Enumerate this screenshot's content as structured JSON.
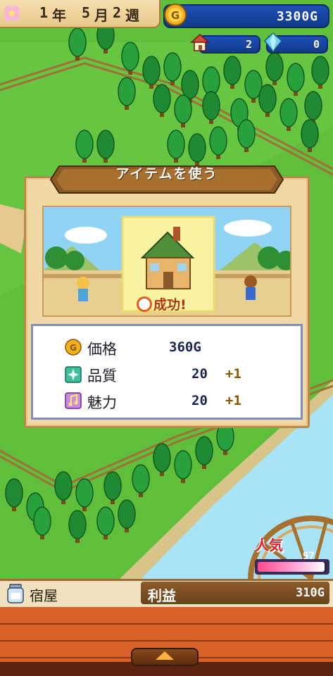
{
  "top_bar": {
    "year_num": "1",
    "year_unit": "年",
    "month_num": "5",
    "month_unit": "月",
    "week_num": "2",
    "week_unit": "週",
    "money": "3300G",
    "houses": "2",
    "crystals": "0"
  },
  "dialog": {
    "title": "アイテムを使う",
    "result": "成功!",
    "rows": [
      {
        "label": "価格",
        "value": "360G",
        "bonus": "",
        "icon": "coin-icon"
      },
      {
        "label": "品質",
        "value": "20",
        "bonus": "+1",
        "icon": "quality-icon"
      },
      {
        "label": "魅力",
        "value": "20",
        "bonus": "+1",
        "icon": "charm-music-icon"
      }
    ]
  },
  "popularity": {
    "label": "人気",
    "value": "97",
    "level_fraction": 0.97
  },
  "bottom_bar": {
    "building": "宿屋",
    "profit_label": "利益",
    "profit_value": "310G"
  },
  "colors": {
    "grass": "#5fbf3a",
    "river": "#9fe0f2",
    "panel_blue": "#1d4fb5",
    "panel_wood": "#f1d9a6"
  }
}
